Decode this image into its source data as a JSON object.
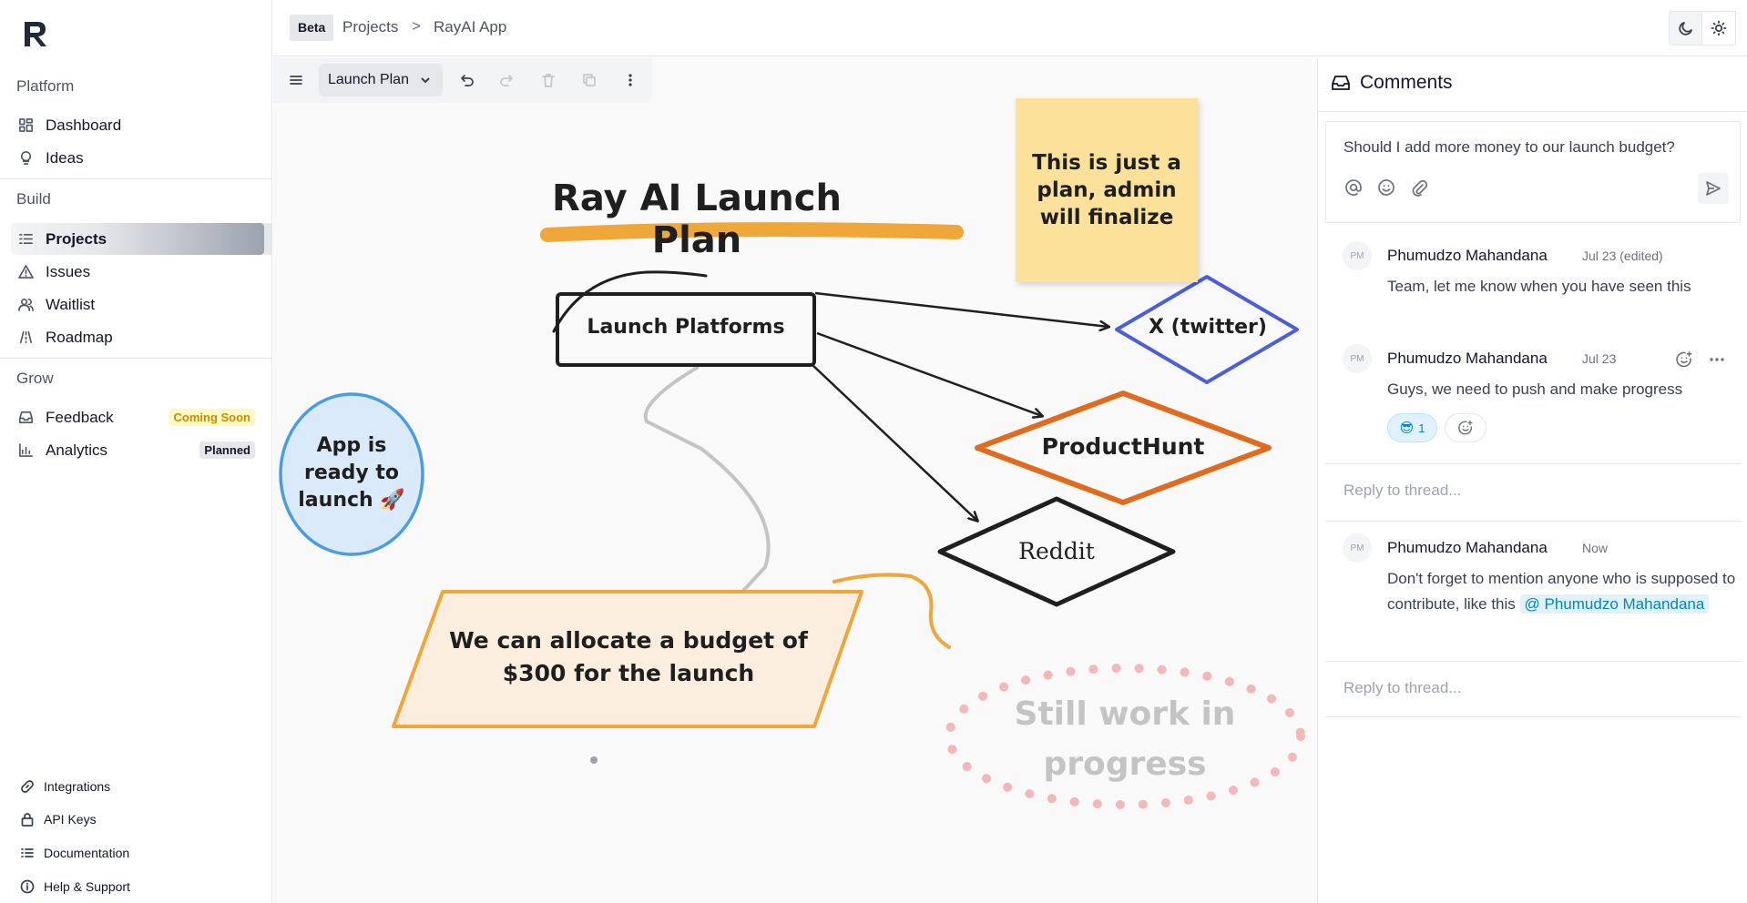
{
  "sidebar": {
    "sections": {
      "platform": "Platform",
      "build": "Build",
      "grow": "Grow"
    },
    "platform_items": [
      {
        "label": "Dashboard",
        "icon": "grid-icon"
      },
      {
        "label": "Ideas",
        "icon": "lightbulb-icon"
      }
    ],
    "build_items": [
      {
        "label": "Projects",
        "icon": "list-icon",
        "active": true
      },
      {
        "label": "Issues",
        "icon": "warning-icon"
      },
      {
        "label": "Waitlist",
        "icon": "users-icon"
      },
      {
        "label": "Roadmap",
        "icon": "roadmap-icon"
      }
    ],
    "grow_items": [
      {
        "label": "Feedback",
        "icon": "inbox-icon",
        "badge": "Coming Soon"
      },
      {
        "label": "Analytics",
        "icon": "chart-icon",
        "badge": "Planned"
      }
    ],
    "bottom_items": [
      {
        "label": "Integrations",
        "icon": "link-icon"
      },
      {
        "label": "API Keys",
        "icon": "lock-icon"
      },
      {
        "label": "Documentation",
        "icon": "list-icon"
      },
      {
        "label": "Help & Support",
        "icon": "info-icon"
      }
    ]
  },
  "header": {
    "badge": "Beta",
    "breadcrumb": [
      "Projects",
      "RayAI App"
    ],
    "separator": ">"
  },
  "canvas": {
    "toolbar": {
      "document": "Launch Plan"
    },
    "title": "Ray AI Launch Plan",
    "sticky_note": "This is just a plan, admin will finalize",
    "nodes": {
      "launch_platforms": "Launch Platforms",
      "twitter": "X (twitter)",
      "producthunt": "ProductHunt",
      "reddit": "Reddit",
      "app_ready": "App is ready to launch 🚀",
      "budget": "We can allocate a budget of $300 for the launch",
      "wip": "Still work in progress"
    },
    "colors": {
      "title_underline": "#f0a73a",
      "twitter_border": "#4a5fd8",
      "producthunt_border": "#e06b1f",
      "circle_fill": "#dbeafb",
      "circle_border": "#4a9de0",
      "budget_fill": "#fbeede",
      "budget_border": "#f0a73a",
      "sticky": "#fbe19a",
      "wip_dots": "#f4b8b8"
    }
  },
  "comments": {
    "title": "Comments",
    "composer_text": "Should I add more money to our launch budget?",
    "threads": [
      {
        "items": [
          {
            "initials": "PM",
            "author": "Phumudzo Mahandana",
            "date": "Jul 23 (edited)",
            "body": "Team, let me know when you have seen this"
          },
          {
            "initials": "PM",
            "author": "Phumudzo Mahandana",
            "date": "Jul 23",
            "body": "Guys, we need to push and make progress",
            "reaction": {
              "emoji": "😎",
              "count": "1"
            }
          }
        ],
        "reply_placeholder": "Reply to thread..."
      },
      {
        "items": [
          {
            "initials": "PM",
            "author": "Phumudzo Mahandana",
            "date": "Now",
            "body": "Don't forget to mention anyone who is supposed to contribute, like this",
            "mention": "@ Phumudzo Mahandana"
          }
        ],
        "reply_placeholder": "Reply to thread..."
      }
    ]
  }
}
